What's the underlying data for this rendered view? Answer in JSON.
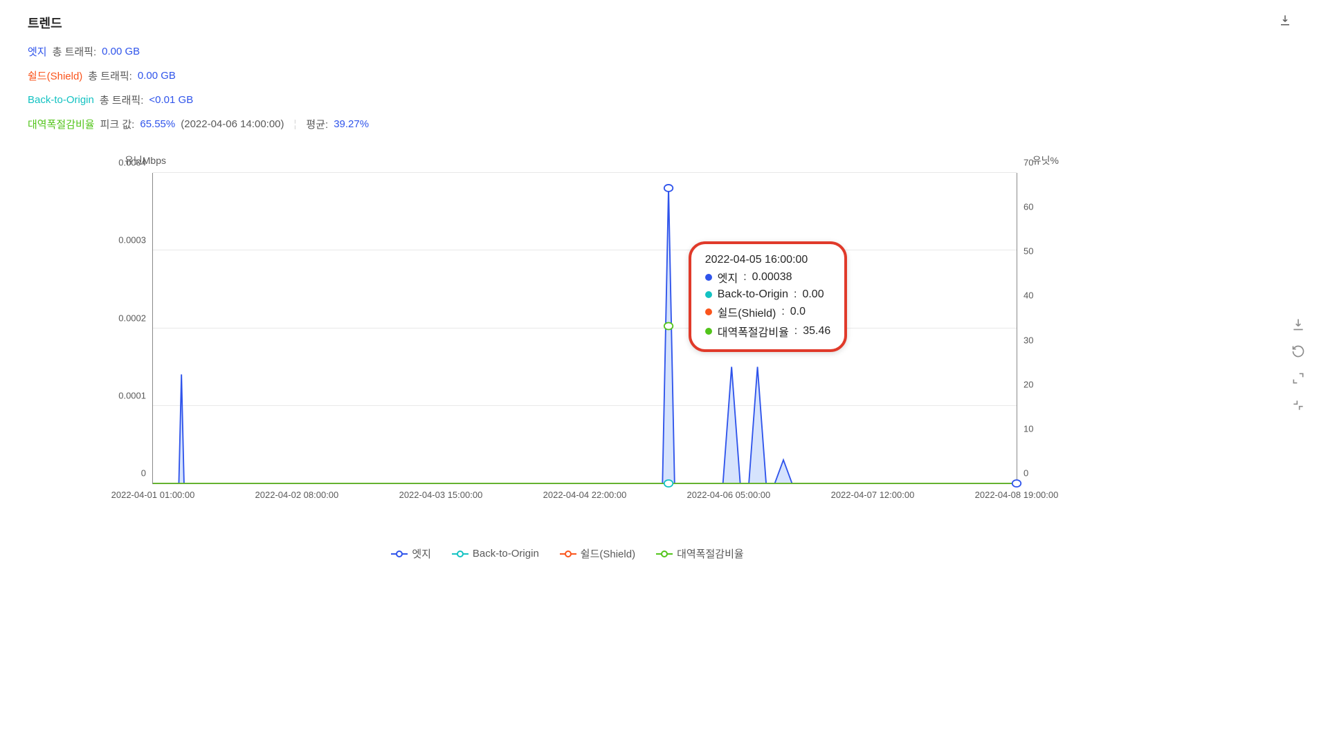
{
  "title": "트렌드",
  "stats": {
    "edge": {
      "label": "엣지",
      "key": "총 트래픽:",
      "value": "0.00 GB"
    },
    "shield": {
      "label": "쉴드(Shield)",
      "key": "총 트래픽:",
      "value": "0.00 GB"
    },
    "bto": {
      "label": "Back-to-Origin",
      "key": "총 트래픽:",
      "value": "<0.01 GB"
    },
    "band": {
      "label": "대역폭절감비율",
      "peak_key": "피크 값:",
      "peak_val": "65.55%",
      "peak_time": "(2022-04-06 14:00:00)",
      "avg_key": "평균:",
      "avg_val": "39.27%"
    }
  },
  "chart": {
    "yaxis_left_label": "유닛Mbps",
    "yaxis_right_label": "유닛%",
    "y_left_ticks": [
      "0",
      "0.0001",
      "0.0002",
      "0.0003",
      "0.0004"
    ],
    "y_right_ticks": [
      "0",
      "10",
      "20",
      "30",
      "40",
      "50",
      "60",
      "70"
    ],
    "x_ticks": [
      "2022-04-01 01:00:00",
      "2022-04-02 08:00:00",
      "2022-04-03 15:00:00",
      "2022-04-04 22:00:00",
      "2022-04-06 05:00:00",
      "2022-04-07 12:00:00",
      "2022-04-08 19:00:00"
    ]
  },
  "tooltip": {
    "time": "2022-04-05 16:00:00",
    "rows": {
      "edge": {
        "label": "엣지",
        "value": "0.00038"
      },
      "bto": {
        "label": "Back-to-Origin",
        "value": "0.00"
      },
      "shield": {
        "label": "쉴드(Shield)",
        "value": "0.0"
      },
      "band": {
        "label": "대역폭절감비율",
        "value": "35.46"
      }
    }
  },
  "legend": {
    "edge": "엣지",
    "bto": "Back-to-Origin",
    "shield": "쉴드(Shield)",
    "band": "대역폭절감비율"
  },
  "chart_data": {
    "type": "line",
    "title": "트렌드",
    "x_range": [
      "2022-04-01 01:00:00",
      "2022-04-08 19:00:00"
    ],
    "yaxis_left": {
      "label": "유닛Mbps",
      "range": [
        0,
        0.0004
      ]
    },
    "yaxis_right": {
      "label": "유닛%",
      "range": [
        0,
        70
      ]
    },
    "series": [
      {
        "name": "엣지",
        "axis": "left",
        "points": [
          {
            "x": "2022-04-01 07:00:00",
            "y": 0.00014
          },
          {
            "x": "2022-04-05 16:00:00",
            "y": 0.00038
          },
          {
            "x": "2022-04-06 06:00:00",
            "y": 0.00015
          },
          {
            "x": "2022-04-06 10:00:00",
            "y": 0.00015
          },
          {
            "x": "2022-04-06 16:00:00",
            "y": 3e-05
          }
        ]
      },
      {
        "name": "Back-to-Origin",
        "axis": "left",
        "points": [
          {
            "x": "2022-04-05 16:00:00",
            "y": 0.0
          }
        ]
      },
      {
        "name": "쉴드(Shield)",
        "axis": "left",
        "points": [
          {
            "x": "2022-04-05 16:00:00",
            "y": 0.0
          }
        ]
      },
      {
        "name": "대역폭절감비율",
        "axis": "right",
        "points": [
          {
            "x": "2022-04-05 16:00:00",
            "y": 35.46
          },
          {
            "x": "2022-04-06 14:00:00",
            "y": 65.55
          }
        ],
        "average": 39.27
      }
    ],
    "tooltip_sample": {
      "time": "2022-04-05 16:00:00",
      "엣지": 0.00038,
      "Back-to-Origin": 0.0,
      "쉴드(Shield)": 0.0,
      "대역폭절감비율": 35.46
    }
  }
}
